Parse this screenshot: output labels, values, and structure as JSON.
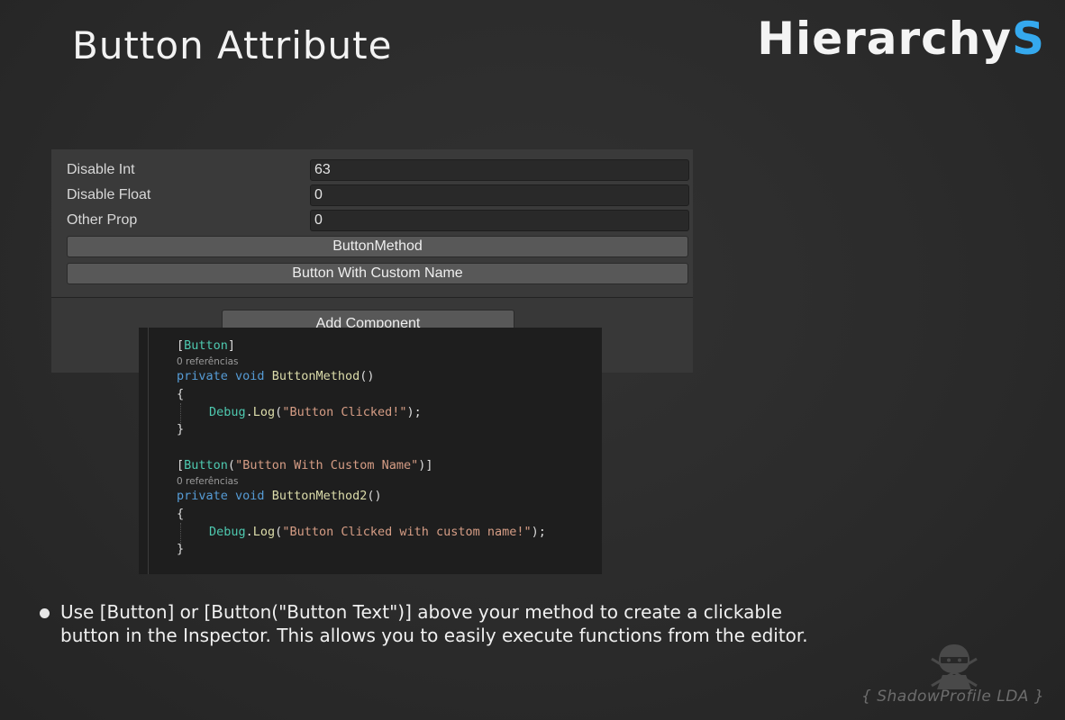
{
  "page": {
    "title": "Button Attribute",
    "brand_main": "Hierarchy",
    "brand_accent": "S",
    "accent_color": "#35a9ee",
    "background_color": "#2b2b2b"
  },
  "inspector": {
    "fields": [
      {
        "label": "Disable Int",
        "value": "63"
      },
      {
        "label": "Disable Float",
        "value": "0"
      },
      {
        "label": "Other Prop",
        "value": "0"
      }
    ],
    "buttons": [
      "ButtonMethod",
      "Button With Custom Name"
    ],
    "add_component_label": "Add Component"
  },
  "code": {
    "refs_label": "0 referências",
    "block1": {
      "attr_open": "[",
      "attr_name": "Button",
      "attr_close": "]",
      "kw_private": "private",
      "kw_void": "void",
      "method": "ButtonMethod",
      "method_parens": "()",
      "brace_open": "{",
      "call_obj": "Debug",
      "call_dot": ".",
      "call_fn": "Log",
      "call_paren_open": "(",
      "call_arg": "\"Button Clicked!\"",
      "call_end": ");",
      "brace_close": "}"
    },
    "block2": {
      "attr_open": "[",
      "attr_name": "Button",
      "attr_paren_open": "(",
      "attr_arg": "\"Button With Custom Name\"",
      "attr_close": ")]",
      "kw_private": "private",
      "kw_void": "void",
      "method": "ButtonMethod2",
      "method_parens": "()",
      "brace_open": "{",
      "call_obj": "Debug",
      "call_dot": ".",
      "call_fn": "Log",
      "call_paren_open": "(",
      "call_arg": "\"Button Clicked with custom name!\"",
      "call_end": ");",
      "brace_close": "}"
    }
  },
  "description": {
    "line1": "Use [Button] or [Button(\"Button Text\")] above your method to create a clickable",
    "line2": "button in the Inspector. This allows you to easily execute functions from the editor."
  },
  "watermark": {
    "text": "{ ShadowProfile LDA }",
    "icon": "ninja-icon"
  }
}
